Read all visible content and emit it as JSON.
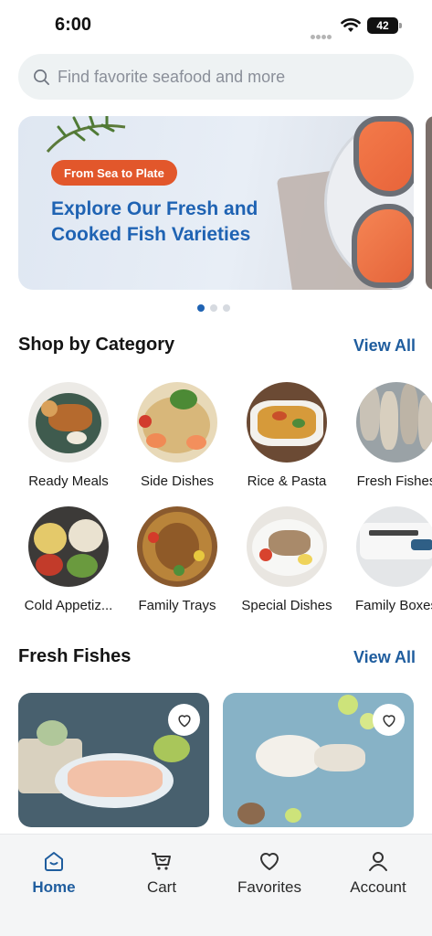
{
  "status_bar": {
    "time": "6:00",
    "battery": "42"
  },
  "search": {
    "placeholder": "Find favorite seafood and more"
  },
  "banner": {
    "tag": "From Sea to Plate",
    "title": "Explore Our Fresh and Cooked Fish Varieties"
  },
  "carousel": {
    "pages": 3,
    "active": 0
  },
  "categories_section": {
    "title": "Shop by Category",
    "view_all": "View All",
    "items": [
      {
        "label": "Ready Meals"
      },
      {
        "label": "Side Dishes"
      },
      {
        "label": "Rice & Pasta"
      },
      {
        "label": "Fresh Fishes"
      },
      {
        "label": "Cold Appetiz..."
      },
      {
        "label": "Family Trays"
      },
      {
        "label": "Special Dishes"
      },
      {
        "label": "Family Boxes"
      }
    ]
  },
  "fresh_section": {
    "title": "Fresh Fishes",
    "view_all": "View All"
  },
  "tabbar": {
    "items": [
      {
        "label": "Home",
        "icon": "home-icon",
        "active": true
      },
      {
        "label": "Cart",
        "icon": "cart-icon",
        "active": false
      },
      {
        "label": "Favorites",
        "icon": "heart-icon",
        "active": false
      },
      {
        "label": "Account",
        "icon": "user-icon",
        "active": false
      }
    ]
  },
  "colors": {
    "accent": "#1f5d9e",
    "banner_title": "#1f63b3",
    "banner_tag": "#e2572b"
  }
}
